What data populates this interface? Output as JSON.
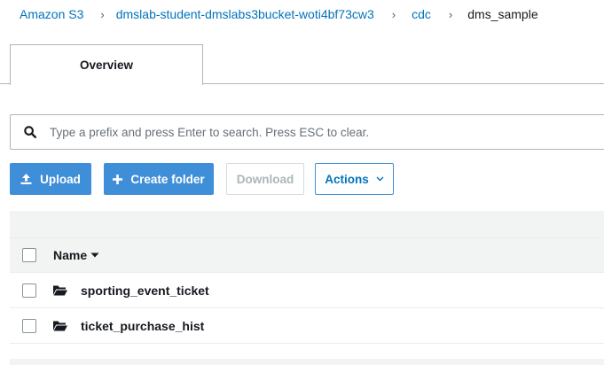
{
  "breadcrumb": {
    "items": [
      "Amazon S3",
      "dmslab-student-dmslabs3bucket-woti4bf73cw3",
      "cdc"
    ],
    "separator": "›",
    "current": "dms_sample"
  },
  "tabs": [
    {
      "label": "Overview",
      "active": true
    }
  ],
  "search": {
    "placeholder": "Type a prefix and press Enter to search. Press ESC to clear.",
    "value": ""
  },
  "toolbar": {
    "upload": {
      "label": "Upload",
      "icon": "upload-icon",
      "enabled": true
    },
    "create_folder": {
      "label": "Create folder",
      "icon": "plus-icon",
      "enabled": true
    },
    "download": {
      "label": "Download",
      "enabled": false
    },
    "actions": {
      "label": "Actions",
      "icon": "chevron-down-icon",
      "enabled": true
    }
  },
  "table": {
    "columns": [
      {
        "label": "Name",
        "sort": "descending",
        "icon": "caret-down-icon"
      }
    ],
    "rows": [
      {
        "name": "sporting_event_ticket",
        "type": "folder",
        "icon": "folder-open-icon",
        "checked": false
      },
      {
        "name": "ticket_purchase_hist",
        "type": "folder",
        "icon": "folder-open-icon",
        "checked": false
      }
    ]
  },
  "colors": {
    "link": "#0073bb",
    "primary": "#3f8ed8",
    "disabled_text": "#aab7b8",
    "band": "#f2f3f3"
  }
}
